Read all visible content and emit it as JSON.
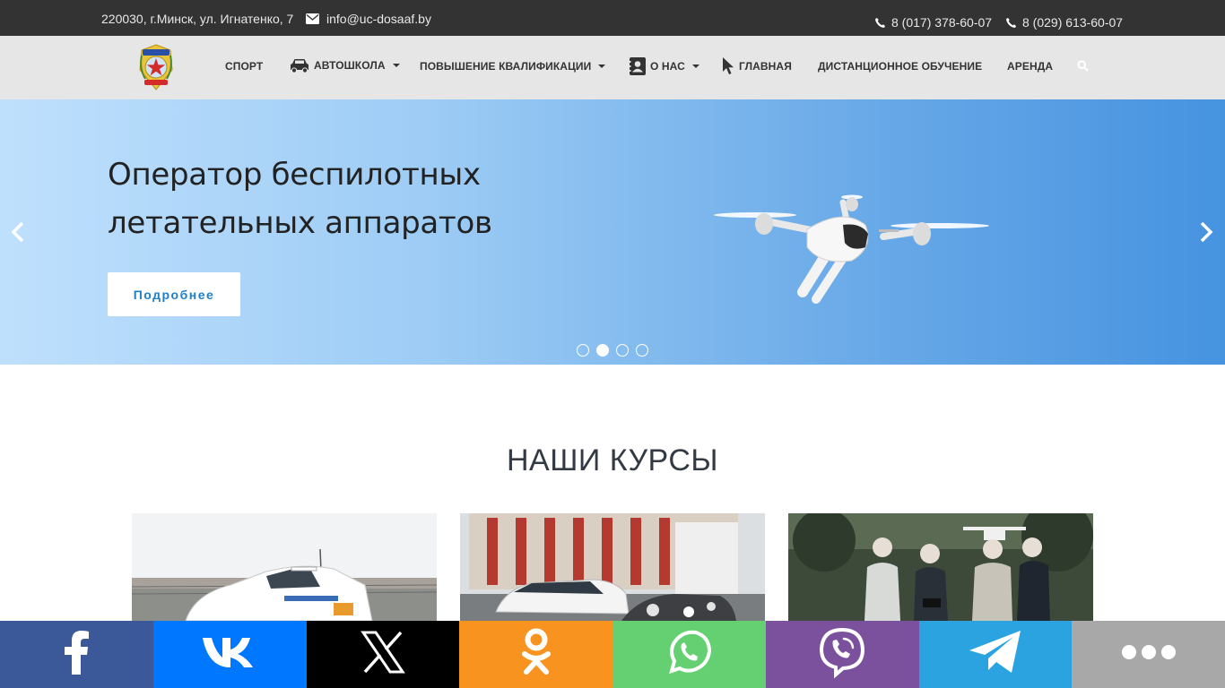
{
  "topbar": {
    "address": "220030, г.Минск, ул. Игнатенко, 7",
    "email": "info@uc-dosaaf.by",
    "phone1": "8 (017) 378-60-07",
    "phone2": "8 (029) 613-60-07"
  },
  "nav": {
    "items": [
      {
        "label": "СПОРТ"
      },
      {
        "label": "АВТОШКОЛА"
      },
      {
        "label": "ПОВЫШЕНИЕ КВАЛИФИКАЦИИ"
      },
      {
        "label": "О НАС"
      },
      {
        "label": "ГЛАВНАЯ"
      },
      {
        "label": "ДИСТАНЦИОННОЕ ОБУЧЕНИЕ"
      },
      {
        "label": "АРЕНДА"
      }
    ]
  },
  "hero": {
    "title": "Оператор беспилотных летательных аппаратов",
    "button": "Подробнее",
    "slide_count": 4,
    "active_slide": 2
  },
  "courses": {
    "title": "НАШИ КУРСЫ"
  },
  "share": {
    "networks": [
      {
        "name": "facebook",
        "color": "#3b5998"
      },
      {
        "name": "vk",
        "color": "#0077ff"
      },
      {
        "name": "x",
        "color": "#000000"
      },
      {
        "name": "odnoklassniki",
        "color": "#f7931e"
      },
      {
        "name": "whatsapp",
        "color": "#65d072"
      },
      {
        "name": "viber",
        "color": "#7b519d"
      },
      {
        "name": "telegram",
        "color": "#2aa3e0"
      },
      {
        "name": "more",
        "color": "#a8a8a8"
      }
    ]
  }
}
